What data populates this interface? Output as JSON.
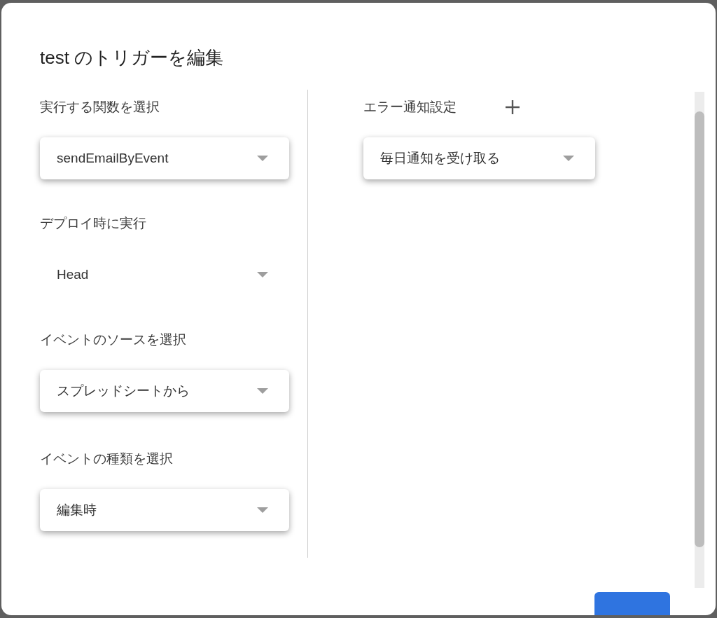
{
  "dialog": {
    "title": "test のトリガーを編集"
  },
  "left_fields": [
    {
      "label": "実行する関数を選択",
      "value": "sendEmailByEvent",
      "kind": "raised"
    },
    {
      "label": "デプロイ時に実行",
      "value": "Head",
      "kind": "flat"
    },
    {
      "label": "イベントのソースを選択",
      "value": "スプレッドシートから",
      "kind": "raised"
    },
    {
      "label": "イベントの種類を選択",
      "value": "編集時",
      "kind": "raised"
    }
  ],
  "right_fields": [
    {
      "label": "エラー通知設定",
      "value": "毎日通知を受け取る",
      "kind": "raised"
    }
  ]
}
